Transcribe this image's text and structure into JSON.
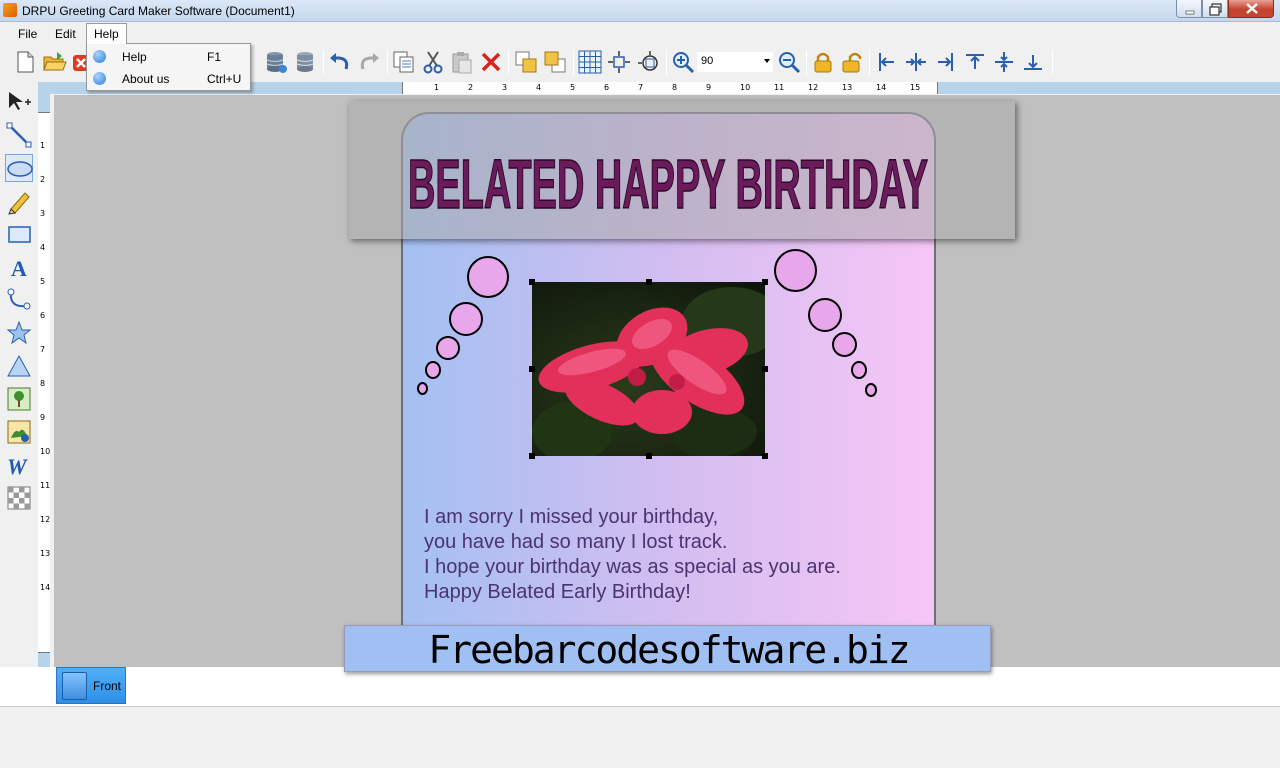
{
  "window": {
    "title": "DRPU Greeting Card Maker Software  (Document1)"
  },
  "menu": {
    "file": "File",
    "edit": "Edit",
    "help": "Help"
  },
  "help_menu": {
    "items": [
      {
        "label": "Help",
        "shortcut": "F1",
        "icon": "help-icon"
      },
      {
        "label": "About us",
        "shortcut": "Ctrl+U",
        "icon": "info-icon"
      }
    ]
  },
  "toolbar": {
    "zoom_value": "90"
  },
  "ruler": {
    "top_numbers": [
      "1",
      "2",
      "3",
      "4",
      "5",
      "6",
      "7",
      "8",
      "9",
      "10",
      "11",
      "12",
      "13",
      "14",
      "15"
    ],
    "left_numbers": [
      "1",
      "2",
      "3",
      "4",
      "5",
      "6",
      "7",
      "8",
      "9",
      "10",
      "11",
      "12",
      "13",
      "14"
    ]
  },
  "card": {
    "heading": "BELATED HAPPY BIRTHDAY",
    "message_lines": [
      "I am sorry I missed your birthday,",
      "you have had so many I lost track.",
      "I hope your birthday was as special as you are.",
      "Happy Belated Early Birthday!"
    ],
    "footer": "Freebarcodesoftware.biz",
    "colors": {
      "heading_fill": "#6b1a5c",
      "bubble_fill": "#e8a7ea",
      "gradient_left": "#a4c0f2",
      "gradient_right": "#f6c6f6",
      "footer_band": "#a0bff2",
      "message_text": "#4a3470"
    }
  },
  "tabs": {
    "front": "Front"
  }
}
